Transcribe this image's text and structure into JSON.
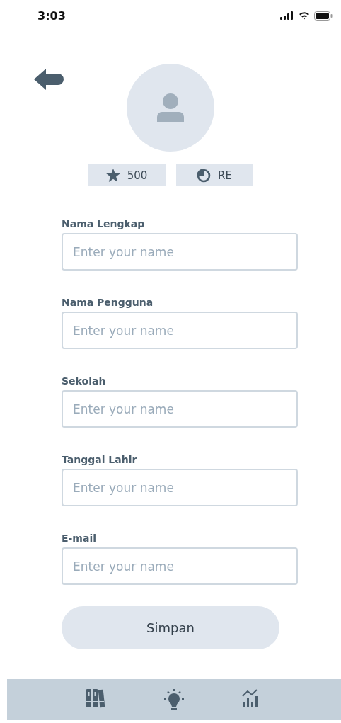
{
  "status_bar": {
    "time": "3:03"
  },
  "profile": {
    "points": "500",
    "reset_label": "RE"
  },
  "fields": [
    {
      "label": "Nama Lengkap",
      "placeholder": "Enter your name"
    },
    {
      "label": "Nama Pengguna",
      "placeholder": "Enter your name"
    },
    {
      "label": "Sekolah",
      "placeholder": "Enter your name"
    },
    {
      "label": "Tanggal Lahir",
      "placeholder": "Enter your name"
    },
    {
      "label": "E-mail",
      "placeholder": "Enter your name"
    }
  ],
  "save_button": "Simpan",
  "nav": [
    {
      "kind": "books"
    },
    {
      "kind": "bulb"
    },
    {
      "kind": "chart"
    }
  ]
}
